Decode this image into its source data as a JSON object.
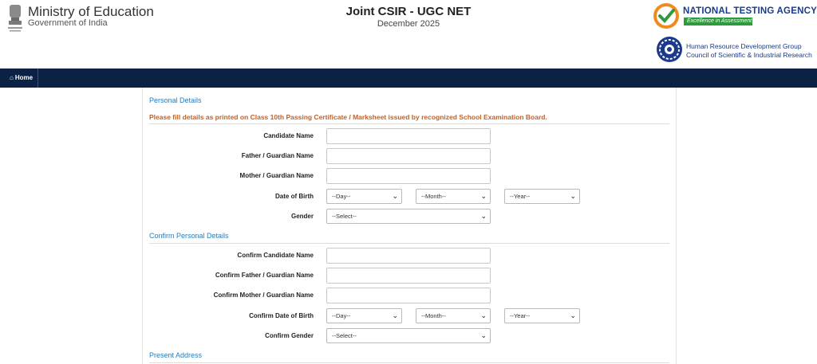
{
  "header": {
    "ministry_title": "Ministry of Education",
    "ministry_subtitle": "Government of India",
    "exam_title": "Joint CSIR - UGC NET",
    "exam_session": "December 2025",
    "nta_name": "NATIONAL TESTING AGENCY",
    "nta_tagline": "Excellence in Assessment",
    "csir_line1": "Human Resource Development Group",
    "csir_line2": "Council of Scientific & Industrial Research"
  },
  "nav": {
    "home_label": "Home"
  },
  "personal": {
    "title": "Personal Details",
    "instruction": "Please fill details as printed on Class 10th Passing Certificate / Marksheet issued by recognized School Examination Board.",
    "candidate_name_label": "Candidate Name",
    "father_label": "Father / Guardian Name",
    "mother_label": "Mother / Guardian Name",
    "dob_label": "Date of Birth",
    "gender_label": "Gender"
  },
  "confirm": {
    "title": "Confirm Personal Details",
    "candidate_name_label": "Confirm Candidate Name",
    "father_label": "Confirm Father / Guardian Name",
    "mother_label": "Confirm Mother / Guardian Name",
    "dob_label": "Confirm Date of Birth",
    "gender_label": "Confirm Gender"
  },
  "selects": {
    "day": "--Day--",
    "month": "--Month--",
    "year": "--Year--",
    "gender": "--Select--"
  },
  "address": {
    "title": "Present Address"
  },
  "colors": {
    "nav_bg": "#0c2244",
    "section_title": "#2c7bb6",
    "instruction": "#c0622a",
    "nta_blue": "#1b3a8a",
    "nta_green": "#2e9a3d"
  },
  "icons": {
    "emblem": "national-emblem-icon",
    "nta": "nta-logo-icon",
    "csir": "csir-logo-icon",
    "home": "home-icon"
  }
}
